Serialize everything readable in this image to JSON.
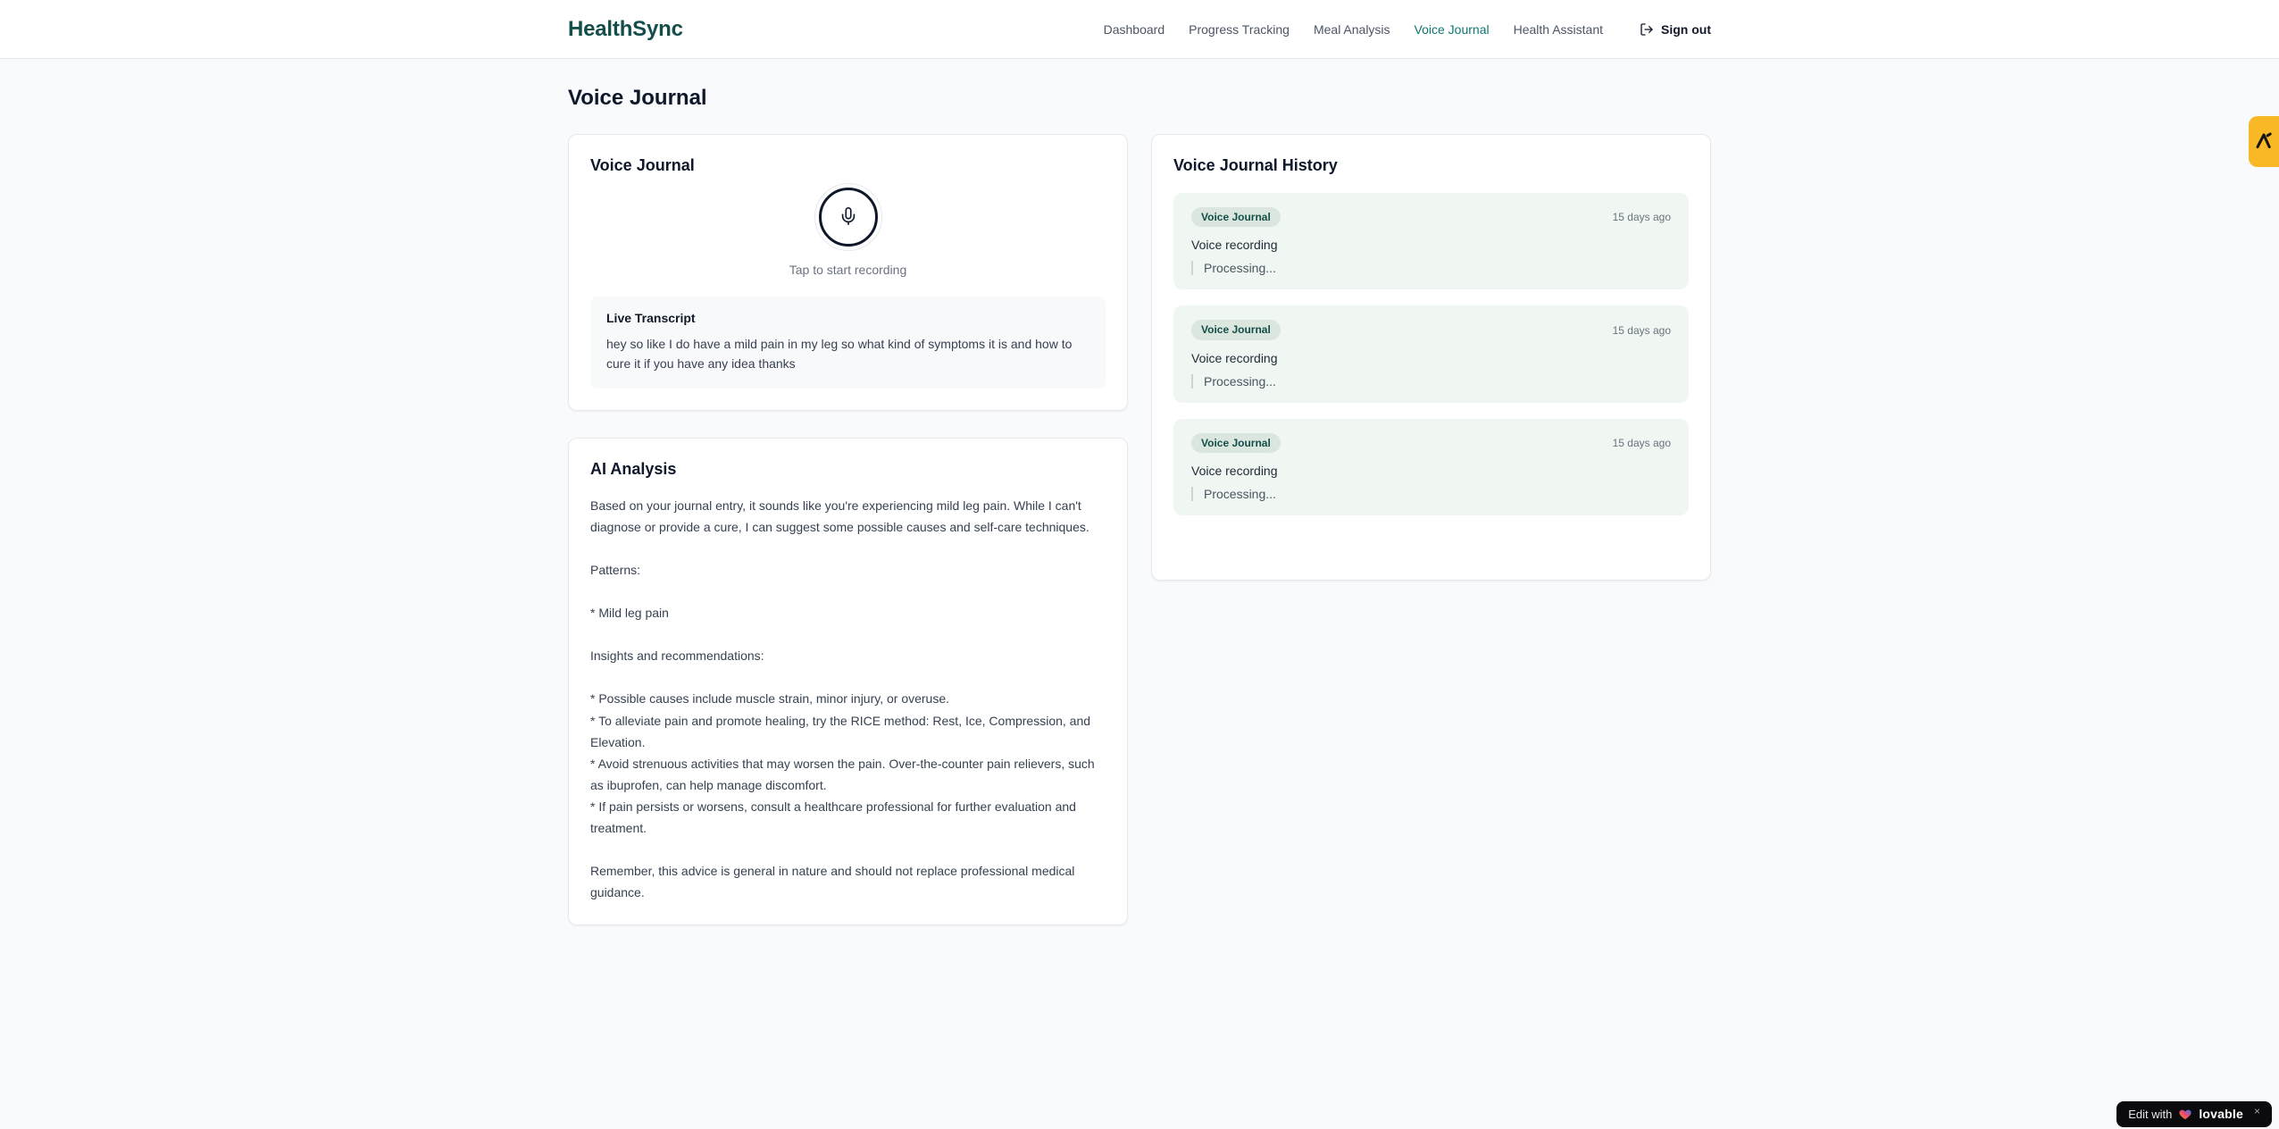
{
  "brand": {
    "name": "HealthSync",
    "color": "#134e4a"
  },
  "nav": {
    "items": [
      {
        "label": "Dashboard",
        "active": false
      },
      {
        "label": "Progress Tracking",
        "active": false
      },
      {
        "label": "Meal Analysis",
        "active": false
      },
      {
        "label": "Voice Journal",
        "active": true
      },
      {
        "label": "Health Assistant",
        "active": false
      }
    ],
    "active_color": "#0f766e",
    "sign_out_label": "Sign out"
  },
  "page": {
    "title": "Voice Journal"
  },
  "recorder_card": {
    "title": "Voice Journal",
    "mic_hint": "Tap to start recording",
    "transcript": {
      "title": "Live Transcript",
      "text": "hey so like I do have a mild pain in my leg so what kind of symptoms it is and how to cure it if you have any idea thanks"
    }
  },
  "analysis_card": {
    "title": "AI Analysis",
    "paragraphs": [
      "Based on your journal entry, it sounds like you're experiencing mild leg pain. While I can't diagnose or provide a cure, I can suggest some possible causes and self-care techniques.",
      "Patterns:",
      "* Mild leg pain",
      "Insights and recommendations:",
      "* Possible causes include muscle strain, minor injury, or overuse.\n* To alleviate pain and promote healing, try the RICE method: Rest, Ice, Compression, and Elevation.\n* Avoid strenuous activities that may worsen the pain. Over-the-counter pain relievers, such as ibuprofen, can help manage discomfort.\n* If pain persists or worsens, consult a healthcare professional for further evaluation and treatment.",
      "Remember, this advice is general in nature and should not replace professional medical guidance."
    ]
  },
  "history_card": {
    "title": "Voice Journal History",
    "entry_background": "#f0f6f1",
    "badge_background": "#dbe6de",
    "entries": [
      {
        "badge": "Voice Journal",
        "time": "15 days ago",
        "label": "Voice recording",
        "status": "Processing..."
      },
      {
        "badge": "Voice Journal",
        "time": "15 days ago",
        "label": "Voice recording",
        "status": "Processing..."
      },
      {
        "badge": "Voice Journal",
        "time": "15 days ago",
        "label": "Voice recording",
        "status": "Processing..."
      }
    ]
  },
  "feedback_widget": {
    "color": "#f9b825"
  },
  "lovable_badge": {
    "prefix": "Edit with",
    "brand": "lovable",
    "close": "×"
  }
}
